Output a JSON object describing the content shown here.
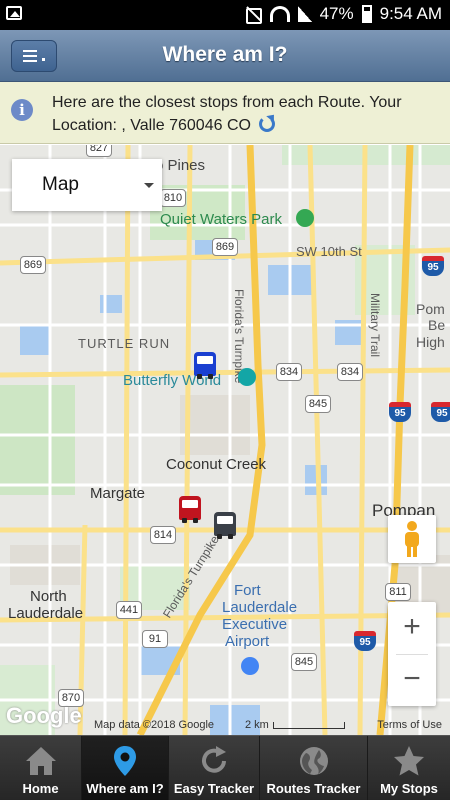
{
  "status_bar": {
    "battery": "47%",
    "time": "9:54 AM"
  },
  "header": {
    "title": "Where am I?",
    "menu_icon": "list-menu-icon"
  },
  "info": {
    "text": "Here are the closest stops from each Route. Your Location: , Valle 760046 CO",
    "icon": "info-icon"
  },
  "map": {
    "type_selector": "Map",
    "labels": {
      "pines": "ro Pines",
      "quiet_waters": "Quiet Waters Park",
      "sw10": "SW 10th St",
      "turnpike_n": "Florida's Turnpike",
      "military": "Military Trail",
      "turtle_run": "TURTLE RUN",
      "butterfly": "Butterfly World",
      "coconut": "Coconut Creek",
      "margate": "Margate",
      "pompano": "Pompan",
      "pompano_beach_1": "Pom",
      "pompano_beach_2": "Be",
      "pompano_beach_3": "High",
      "turnpike_s": "Florida's Turnpike",
      "north": "North",
      "lauderdale": "Lauderdale",
      "fort": "Fort",
      "fort2": "Lauderdale",
      "fort3": "Executive",
      "fort4": "Airport"
    },
    "shields": {
      "s827": "827",
      "s810": "810",
      "s869a": "869",
      "s869b": "869",
      "s834a": "834",
      "s834b": "834",
      "s845a": "845",
      "s845b": "845",
      "s814": "814",
      "s441": "441",
      "s91": "91",
      "s870": "870",
      "s811": "811"
    },
    "interstates": {
      "i95a": "95",
      "i95b": "95",
      "i95c": "95",
      "i95d": "95"
    },
    "attribution": "Map data ©2018 Google",
    "scale": "2 km",
    "terms": "Terms of Use",
    "google": "Google"
  },
  "colors": {
    "bus_blue": "#1a3fd1",
    "bus_red": "#c0141f",
    "bus_gray": "#3a4048"
  },
  "tabs": [
    {
      "label": "Home",
      "icon": "home-icon"
    },
    {
      "label": "Where am I?",
      "icon": "location-pin-icon"
    },
    {
      "label": "Easy Tracker",
      "icon": "refresh-icon"
    },
    {
      "label": "Routes Tracker",
      "icon": "globe-icon"
    },
    {
      "label": "My Stops",
      "icon": "star-icon"
    }
  ]
}
